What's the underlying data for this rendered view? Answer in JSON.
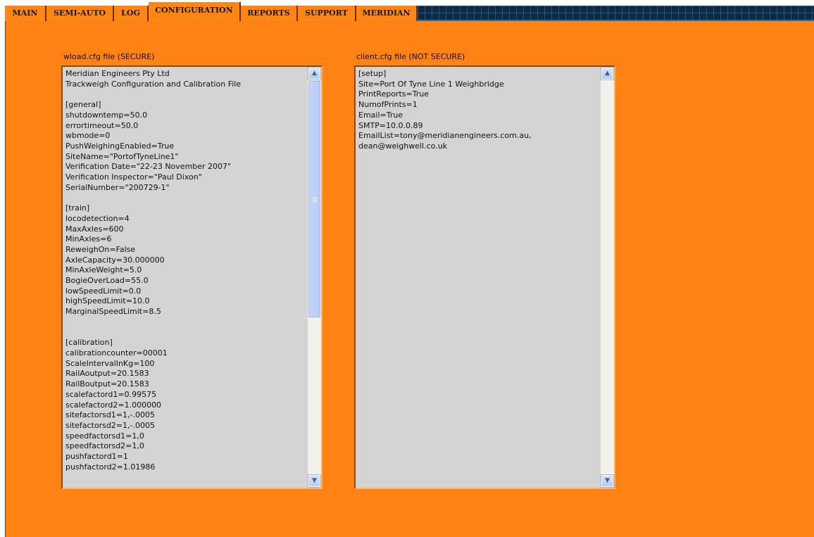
{
  "tabs": [
    {
      "label": "MAIN",
      "active": false
    },
    {
      "label": "SEMI-AUTO",
      "active": false
    },
    {
      "label": "LOG",
      "active": false
    },
    {
      "label": "CONFIGURATION",
      "active": true
    },
    {
      "label": "REPORTS",
      "active": false
    },
    {
      "label": "SUPPORT",
      "active": false
    },
    {
      "label": "MERIDIAN",
      "active": false
    }
  ],
  "secure_file": {
    "label": "wload.cfg file (SECURE)",
    "text": "Meridian Engineers Pty Ltd\nTrackweigh Configuration and Calibration File\n\n[general]\nshutdowntemp=50.0\nerrortimeout=50.0\nwbmode=0\nPushWeighingEnabled=True\nSiteName=\"PortofTyneLine1\"\nVerification Date=\"22-23 November 2007\"\nVerification Inspector=\"Paul Dixon\"\nSerialNumber=\"200729-1\"\n\n[train]\nlocodetection=4\nMaxAxles=600\nMinAxles=6\nReweighOn=False\nAxleCapacity=30.000000\nMinAxleWeight=5.0\nBogieOverLoad=55.0\nlowSpeedLimit=0.0\nhighSpeedLimit=10.0\nMarginalSpeedLimit=8.5\n\n\n[calibration]\ncalibrationcounter=00001\nScaleIntervalInKg=100\nRailAoutput=20.1583\nRailBoutput=20.1583\nscalefactord1=0.99575\nscalefactord2=1.000000\nsitefactorsd1=1,-.0005\nsitefactorsd2=1,-.0005\nspeedfactorsd1=1,0\nspeedfactorsd2=1,0\npushfactord1=1\npushfactord2=1.01986"
  },
  "client_file": {
    "label": "client.cfg file (NOT SECURE)",
    "text": "[setup]\nSite=Port Of Tyne Line 1 Weighbridge\nPrintReports=True\nNumofPrints=1\nEmail=True\nSMTP=10.0.0.89\nEmailList=tony@meridianengineers.com.au,\ndean@weighwell.co.uk"
  },
  "icons": {
    "scroll_up": "scroll-up-arrow",
    "scroll_down": "scroll-down-arrow"
  },
  "colors": {
    "panel": "#ff8214",
    "tab": "#ff8514",
    "textbox": "#d4d4d4",
    "grid": "#0b2a45"
  }
}
